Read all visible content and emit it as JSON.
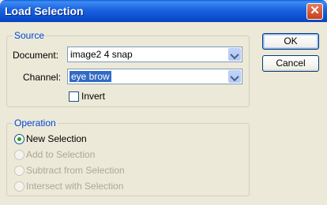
{
  "window": {
    "title": "Load Selection",
    "close_glyph": "✕"
  },
  "source": {
    "legend": "Source",
    "document_label": "Document:",
    "document_value": "image2 4 snap",
    "channel_label": "Channel:",
    "channel_value": "eye brow",
    "invert_label": "Invert",
    "invert_checked": false
  },
  "operation": {
    "legend": "Operation",
    "options": [
      {
        "label": "New Selection",
        "selected": true,
        "enabled": true
      },
      {
        "label": "Add to Selection",
        "selected": false,
        "enabled": false
      },
      {
        "label": "Subtract from Selection",
        "selected": false,
        "enabled": false
      },
      {
        "label": "Intersect with Selection",
        "selected": false,
        "enabled": false
      }
    ]
  },
  "buttons": {
    "ok": "OK",
    "cancel": "Cancel"
  },
  "colors": {
    "title_bar": "#0b4fd1",
    "dialog_bg": "#ece9d8",
    "legend_text": "#0046d5",
    "selection_highlight": "#316ac5"
  }
}
